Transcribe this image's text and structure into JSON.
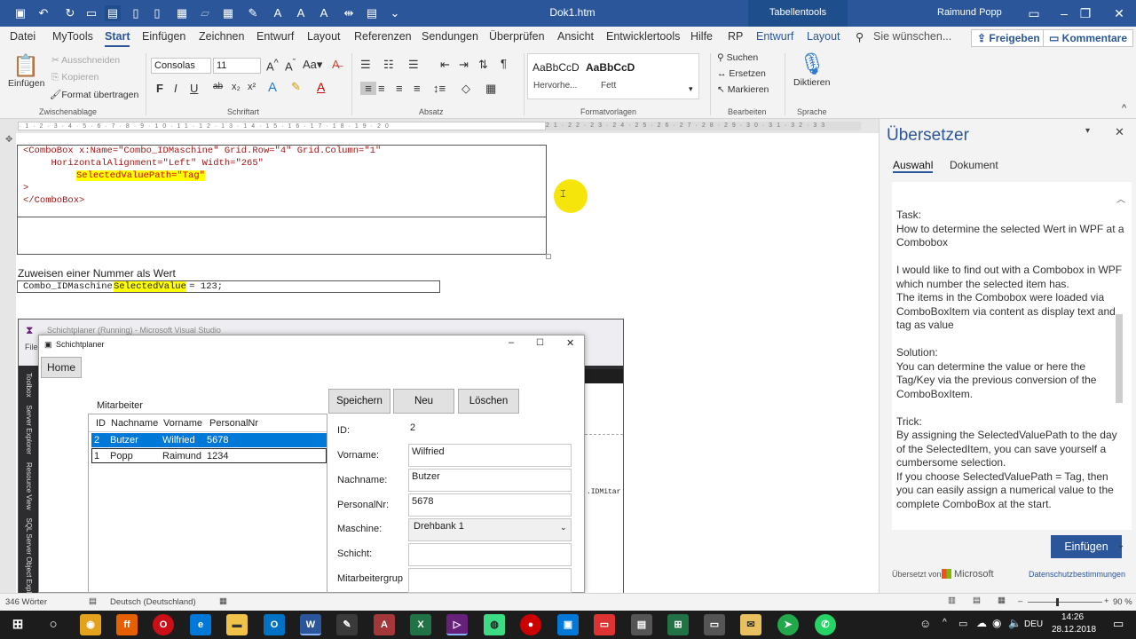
{
  "titlebar": {
    "document": "Dok1.htm",
    "context_tab": "Tabellentools",
    "user": "Raimund Popp"
  },
  "tabs": [
    "Datei",
    "MyTools",
    "Start",
    "Einfügen",
    "Zeichnen",
    "Entwurf",
    "Layout",
    "Referenzen",
    "Sendungen",
    "Überprüfen",
    "Ansicht",
    "Entwicklertools",
    "Hilfe",
    "RP",
    "Entwurf",
    "Layout"
  ],
  "tell_me": "Sie wünschen...",
  "share": "Freigeben",
  "comments": "Kommentare",
  "ribbon": {
    "paste": "Einfügen",
    "cut": "Ausschneiden",
    "copy": "Kopieren",
    "format_painter": "Format übertragen",
    "clipboard": "Zwischenablage",
    "font_name": "Consolas",
    "font_size": "11",
    "font": "Schriftart",
    "paragraph": "Absatz",
    "style1_preview": "AaBbCcD",
    "style1_name": "Hervorhe...",
    "style2_preview": "AaBbCcD",
    "style2_name": "Fett",
    "styles": "Formatvorlagen",
    "find": "Suchen",
    "replace": "Ersetzen",
    "select": "Markieren",
    "editing": "Bearbeiten",
    "dictate": "Diktieren",
    "voice": "Sprache"
  },
  "doc": {
    "code1": "<ComboBox x:Name=\"Combo_IDMaschine\" Grid.Row=\"4\" Grid.Column=\"1\"",
    "code2": "     HorizontalAlignment=\"Left\" Width=\"265\"",
    "code3": "SelectedValuePath=\"Tag\"",
    "code4": ">",
    "code5": "</ComboBox>",
    "heading": "Zuweisen einer Nummer als Wert",
    "assign_pre": "Combo_IDMaschine.",
    "assign_hl": "SelectedValue",
    "assign_post": " = 123;"
  },
  "vs": {
    "title": "Schichtplaner (Running) - Microsoft Visual Studio",
    "file": "File",
    "side_tabs": [
      "Toolbox",
      "Server Explorer",
      "Resource View",
      "SQL Server Object Explo"
    ],
    "code_snippet": ".IDMitar"
  },
  "app": {
    "title": "Schichtplaner",
    "home": "Home",
    "section": "Mitarbeiter",
    "save": "Speichern",
    "new": "Neu",
    "delete": "Löschen",
    "columns": [
      "ID",
      "Nachname",
      "Vorname",
      "PersonalNr"
    ],
    "rows": [
      [
        "2",
        "Butzer",
        "Wilfried",
        "5678"
      ],
      [
        "1",
        "Popp",
        "Raimund",
        "1234"
      ]
    ],
    "labels": {
      "id": "ID:",
      "firstname": "Vorname:",
      "lastname": "Nachname:",
      "pnr": "PersonalNr:",
      "machine": "Maschine:",
      "shift": "Schicht:",
      "group": "Mitarbeitergrup"
    },
    "values": {
      "id": "2",
      "firstname": "Wilfried",
      "lastname": "Butzer",
      "pnr": "5678",
      "machine": "Drehbank 1",
      "shift": "",
      "group": ""
    }
  },
  "translator": {
    "title": "Übersetzer",
    "tab_selection": "Auswahl",
    "tab_document": "Dokument",
    "text": "Task:\nHow to determine the selected Wert in WPF at a Combobox\n\nI would like to find out with a Combobox in WPF which number the selected item has.\nThe items in the Combobox were loaded via ComboBoxItem via content as display text and tag as value\n\nSolution:\nYou can determine the value or here the Tag/Key via the previous conversion of the ComboBoxItem.\n\nTrick:\nBy assigning the SelectedValuePath to the day of the SelectedItem, you can save yourself a cumbersome selection.\nIf you choose SelectedValuePath = Tag, then you can easily assign a numerical value to the complete ComboBox at the start.",
    "insert": "Einfügen",
    "translated_by": "Übersetzt von",
    "microsoft": "Microsoft",
    "privacy": "Datenschutzbestimmungen"
  },
  "status": {
    "words": "346 Wörter",
    "language": "Deutsch (Deutschland)",
    "zoom": "90 %"
  },
  "taskbar": {
    "lang": "DEU",
    "time": "14:26",
    "date": "28.12.2018"
  },
  "colors": {
    "word_blue": "#2b579a",
    "selection": "#0078d7",
    "highlight": "#ffff00",
    "cursor_marker": "#f5e50a"
  }
}
